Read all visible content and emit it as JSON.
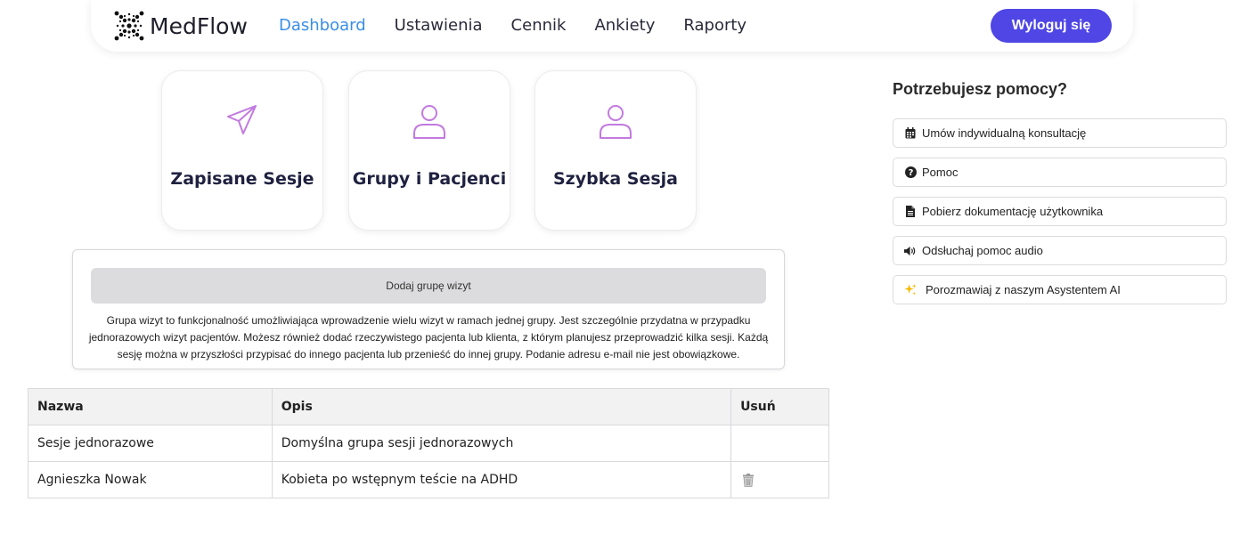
{
  "brand": {
    "name": "MedFlow"
  },
  "nav": {
    "links": [
      "Dashboard",
      "Ustawienia",
      "Cennik",
      "Ankiety",
      "Raporty"
    ],
    "active": "Dashboard",
    "logout_label": "Wyloguj się"
  },
  "cards": [
    {
      "title": "Zapisane Sesje",
      "icon": "paper-plane-icon"
    },
    {
      "title": "Grupy i Pacjenci",
      "icon": "user-icon"
    },
    {
      "title": "Szybka Sesja",
      "icon": "user-icon"
    }
  ],
  "group_box": {
    "button_label": "Dodaj grupę wizyt",
    "description": "Grupa wizyt to funkcjonalność umożliwiająca wprowadzenie wielu wizyt w ramach jednej grupy. Jest szczególnie przydatna w przypadku jednorazowych wizyt pacjentów. Możesz również dodać rzeczywistego pacjenta lub klienta, z którym planujesz przeprowadzić kilka sesji. Każdą sesję można w przyszłości przypisać do innego pacjenta lub przenieść do innej grupy. Podanie adresu e-mail nie jest obowiązkowe."
  },
  "table": {
    "headers": [
      "Nazwa",
      "Opis",
      "Usuń"
    ],
    "rows": [
      {
        "name": "Sesje jednorazowe",
        "desc": "Domyślna grupa sesji jednorazowych",
        "deletable": false
      },
      {
        "name": "Agnieszka Nowak",
        "desc": "Kobieta po wstępnym teście na ADHD",
        "deletable": true
      }
    ]
  },
  "help": {
    "title": "Potrzebujesz pomocy?",
    "items": [
      {
        "label": "Umów indywidualną konsultację",
        "icon": "calendar-icon"
      },
      {
        "label": "Pomoc",
        "icon": "question-circle-icon"
      },
      {
        "label": "Pobierz dokumentację użytkownika",
        "icon": "document-icon"
      },
      {
        "label": "Odsłuchaj pomoc audio",
        "icon": "speaker-icon"
      },
      {
        "label": "Porozmawiaj z naszym Asystentem AI",
        "icon": "sparkles-icon"
      }
    ]
  },
  "colors": {
    "accent": "#4f46e5",
    "active_link": "#3a8ee6",
    "card_icon": "#c27ae0"
  }
}
